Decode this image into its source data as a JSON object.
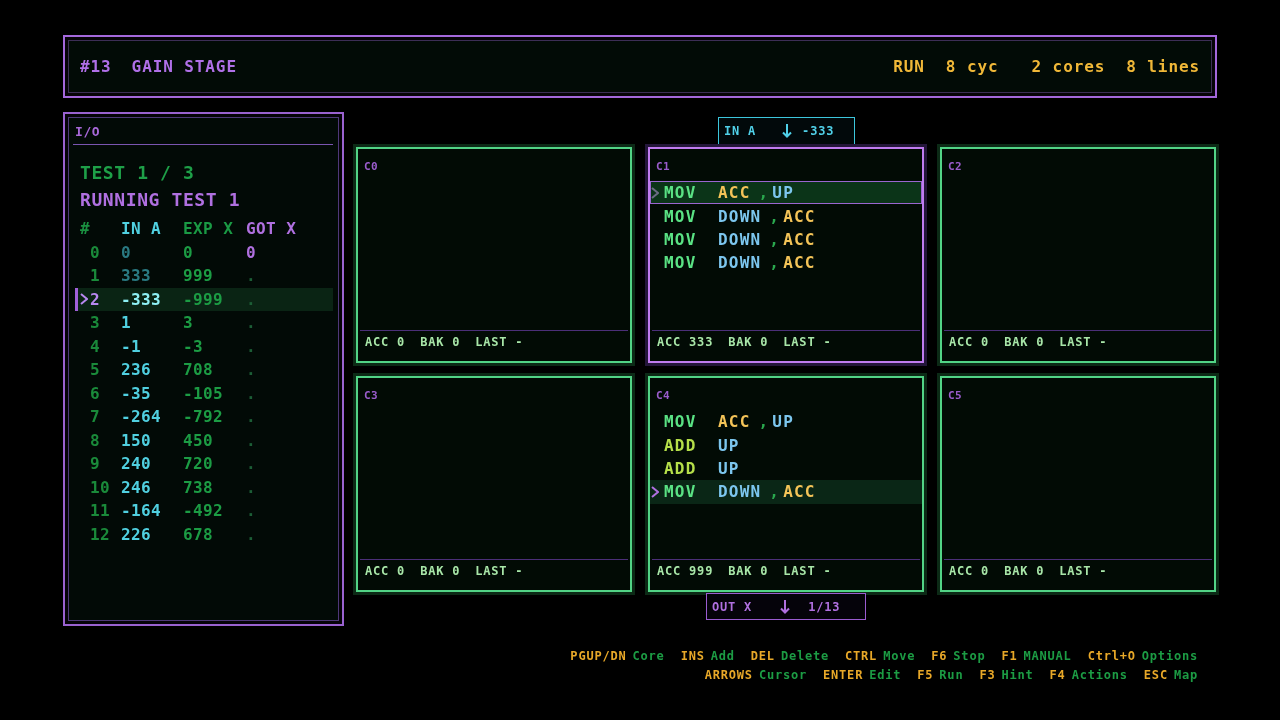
{
  "header": {
    "number": "#13",
    "title": "GAIN STAGE",
    "stats": [
      {
        "kind": "status",
        "text": "RUN"
      },
      {
        "kind": "cycles",
        "text": "8 cyc"
      },
      {
        "kind": "cores",
        "text": "2 cores"
      },
      {
        "kind": "lines",
        "text": "8 lines"
      }
    ]
  },
  "io": {
    "title": "I/O",
    "test_counter": "TEST 1 / 3",
    "test_status": "RUNNING TEST 1",
    "columns": [
      "#",
      "IN A",
      "EXP X",
      "GOT X"
    ],
    "rows": [
      {
        "number": "0",
        "in": "0",
        "expected": "0",
        "got": "0",
        "consumed": true,
        "received": true,
        "selected": false
      },
      {
        "number": "1",
        "in": "333",
        "expected": "999",
        "got": ".",
        "consumed": true,
        "received": false,
        "selected": false
      },
      {
        "number": "2",
        "in": "-333",
        "expected": "-999",
        "got": ".",
        "consumed": false,
        "received": false,
        "selected": true
      },
      {
        "number": "3",
        "in": "1",
        "expected": "3",
        "got": ".",
        "consumed": false,
        "received": false,
        "selected": false
      },
      {
        "number": "4",
        "in": "-1",
        "expected": "-3",
        "got": ".",
        "consumed": false,
        "received": false,
        "selected": false
      },
      {
        "number": "5",
        "in": "236",
        "expected": "708",
        "got": ".",
        "consumed": false,
        "received": false,
        "selected": false
      },
      {
        "number": "6",
        "in": "-35",
        "expected": "-105",
        "got": ".",
        "consumed": false,
        "received": false,
        "selected": false
      },
      {
        "number": "7",
        "in": "-264",
        "expected": "-792",
        "got": ".",
        "consumed": false,
        "received": false,
        "selected": false
      },
      {
        "number": "8",
        "in": "150",
        "expected": "450",
        "got": ".",
        "consumed": false,
        "received": false,
        "selected": false
      },
      {
        "number": "9",
        "in": "240",
        "expected": "720",
        "got": ".",
        "consumed": false,
        "received": false,
        "selected": false
      },
      {
        "number": "10",
        "in": "246",
        "expected": "738",
        "got": ".",
        "consumed": false,
        "received": false,
        "selected": false
      },
      {
        "number": "11",
        "in": "-164",
        "expected": "-492",
        "got": ".",
        "consumed": false,
        "received": false,
        "selected": false
      },
      {
        "number": "12",
        "in": "226",
        "expected": "678",
        "got": ".",
        "consumed": false,
        "received": false,
        "selected": false
      }
    ]
  },
  "cores": [
    {
      "label": "C0",
      "selected": false,
      "stats": [
        "ACC 0",
        "BAK 0",
        "LAST -"
      ]
    },
    {
      "label": "C1",
      "selected": true,
      "ports": [
        {
          "kind": "input",
          "name": "IN A",
          "value": "-333"
        }
      ],
      "lines": [
        {
          "selected": true,
          "tokens": [
            {
              "kind": "move",
              "text": "MOV"
            },
            {
              "kind": "register",
              "text": "ACC"
            },
            {
              "kind": "comma",
              "text": ","
            },
            {
              "kind": "port",
              "text": "UP"
            }
          ]
        },
        {
          "selected": false,
          "tokens": [
            {
              "kind": "move",
              "text": "MOV"
            },
            {
              "kind": "port",
              "text": "DOWN"
            },
            {
              "kind": "comma",
              "text": ","
            },
            {
              "kind": "register",
              "text": "ACC"
            }
          ]
        },
        {
          "selected": false,
          "tokens": [
            {
              "kind": "move",
              "text": "MOV"
            },
            {
              "kind": "port",
              "text": "DOWN"
            },
            {
              "kind": "comma",
              "text": ","
            },
            {
              "kind": "register",
              "text": "ACC"
            }
          ]
        },
        {
          "selected": false,
          "tokens": [
            {
              "kind": "move",
              "text": "MOV"
            },
            {
              "kind": "port",
              "text": "DOWN"
            },
            {
              "kind": "comma",
              "text": ","
            },
            {
              "kind": "register",
              "text": "ACC"
            }
          ]
        }
      ],
      "stats": [
        "ACC 333",
        "BAK 0",
        "LAST -"
      ]
    },
    {
      "label": "C2",
      "selected": false,
      "stats": [
        "ACC 0",
        "BAK 0",
        "LAST -"
      ]
    },
    {
      "label": "C3",
      "selected": false,
      "stats": [
        "ACC 0",
        "BAK 0",
        "LAST -"
      ]
    },
    {
      "label": "C4",
      "selected": false,
      "lines": [
        {
          "selected": false,
          "tokens": [
            {
              "kind": "move",
              "text": "MOV"
            },
            {
              "kind": "register",
              "text": "ACC"
            },
            {
              "kind": "comma",
              "text": ","
            },
            {
              "kind": "port",
              "text": "UP"
            }
          ]
        },
        {
          "selected": false,
          "tokens": [
            {
              "kind": "math",
              "text": "ADD"
            },
            {
              "kind": "port",
              "text": "UP"
            }
          ]
        },
        {
          "selected": false,
          "tokens": [
            {
              "kind": "math",
              "text": "ADD"
            },
            {
              "kind": "port",
              "text": "UP"
            }
          ]
        },
        {
          "selected": true,
          "tokens": [
            {
              "kind": "move",
              "text": "MOV"
            },
            {
              "kind": "port",
              "text": "DOWN"
            },
            {
              "kind": "comma",
              "text": ","
            },
            {
              "kind": "register",
              "text": "ACC"
            }
          ]
        }
      ],
      "stats": [
        "ACC 999",
        "BAK 0",
        "LAST -"
      ],
      "ports": [
        {
          "kind": "output",
          "name": "OUT X",
          "value": "1/13"
        }
      ]
    },
    {
      "label": "C5",
      "selected": false,
      "stats": [
        "ACC 0",
        "BAK 0",
        "LAST -"
      ]
    }
  ],
  "key_hints": [
    [
      {
        "key": "PGUP/DN",
        "action": "Core"
      },
      {
        "key": "INS",
        "action": "Add"
      },
      {
        "key": "DEL",
        "action": "Delete"
      },
      {
        "key": "CTRL",
        "action": "Move"
      },
      {
        "key": "F6",
        "action": "Stop"
      },
      {
        "key": "F1",
        "action": "MANUAL"
      },
      {
        "key": "Ctrl+O",
        "action": "Options"
      }
    ],
    [
      {
        "key": "ARROWS",
        "action": "Cursor"
      },
      {
        "key": "ENTER",
        "action": "Edit"
      },
      {
        "key": "F5",
        "action": "Run"
      },
      {
        "key": "F3",
        "action": "Hint"
      },
      {
        "key": "F4",
        "action": "Actions"
      },
      {
        "key": "ESC",
        "action": "Map"
      }
    ]
  ]
}
